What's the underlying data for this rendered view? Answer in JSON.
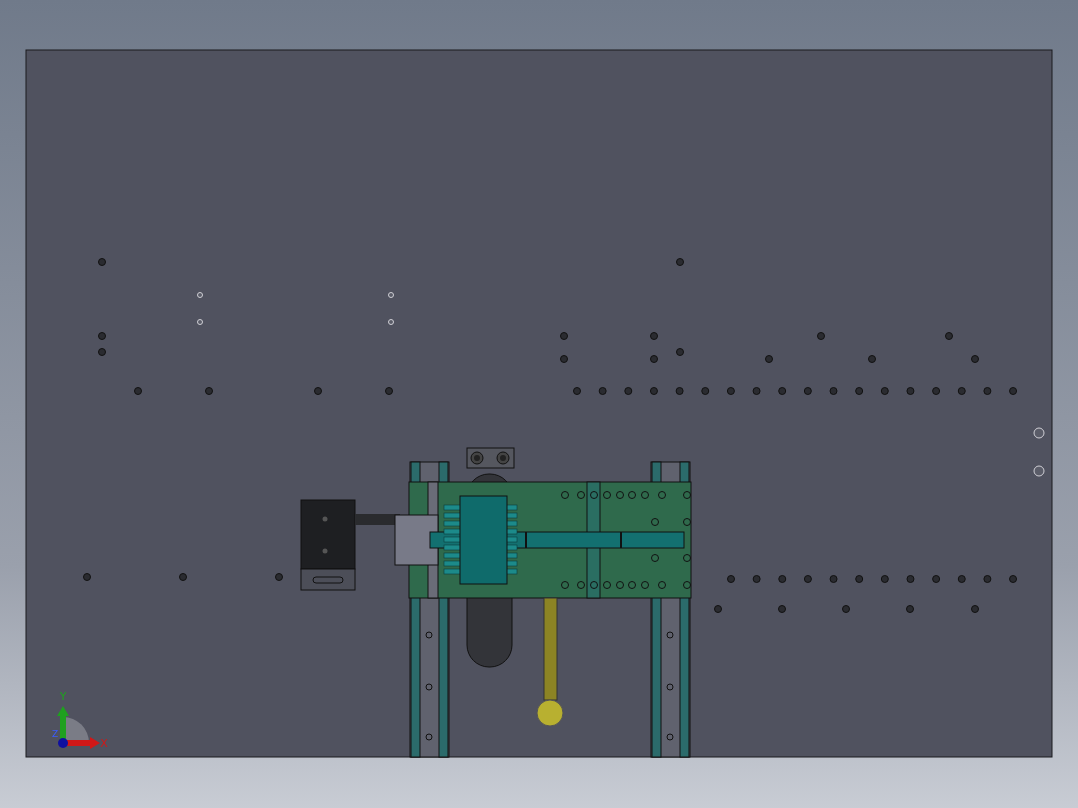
{
  "viewport": {
    "axes": [
      {
        "label": "Y",
        "kind": "y"
      },
      {
        "label": "X",
        "kind": "x"
      },
      {
        "label": "Z",
        "kind": "z"
      }
    ]
  }
}
